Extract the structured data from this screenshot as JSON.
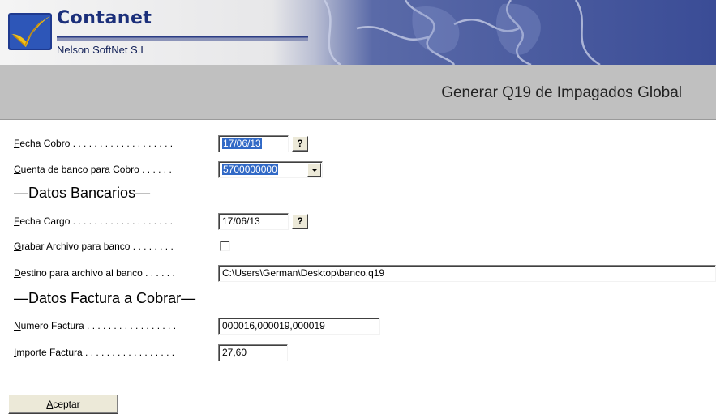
{
  "header": {
    "brand_name": "Contanet",
    "company": "Nelson SoftNet S.L"
  },
  "page": {
    "title": "Generar Q19 de Impagados Global"
  },
  "form": {
    "fecha_cobro": {
      "label_first": "F",
      "label_rest": "echa Cobro",
      "dots": " . . . . . . . . . . . . . . . . . . .",
      "value": "17/06/13",
      "help_label": "?"
    },
    "cuenta_banco": {
      "label_first": "C",
      "label_rest": "uenta de banco para Cobro",
      "dots": " . . . . . .",
      "value": "5700000000"
    },
    "section_bancarios": "—Datos Bancarios—",
    "fecha_cargo": {
      "label_first": "F",
      "label_rest": "echa Cargo",
      "dots": " . . . . . . . . . . . . . . . . . . .",
      "value": "17/06/13",
      "help_label": "?"
    },
    "grabar_archivo": {
      "label_first": "G",
      "label_rest": "rabar Archivo para banco",
      "dots": " . . . . . . . .",
      "checked": false
    },
    "destino_archivo": {
      "label_first": "D",
      "label_rest": "estino para archivo al banco",
      "dots": " . . . . . .",
      "value": "C:\\Users\\German\\Desktop\\banco.q19"
    },
    "section_factura": "—Datos Factura a Cobrar—",
    "numero_factura": {
      "label_first": "N",
      "label_rest": "umero Factura",
      "dots": " . . . . . . . . . . . . . . . . .",
      "value": "000016,000019,000019"
    },
    "importe_factura": {
      "label_first": "I",
      "label_rest": "mporte Factura",
      "dots": " . . . . . . . . . . . . . . . . .",
      "value": "27,60"
    }
  },
  "actions": {
    "accept_first": "A",
    "accept_rest": "ceptar"
  }
}
